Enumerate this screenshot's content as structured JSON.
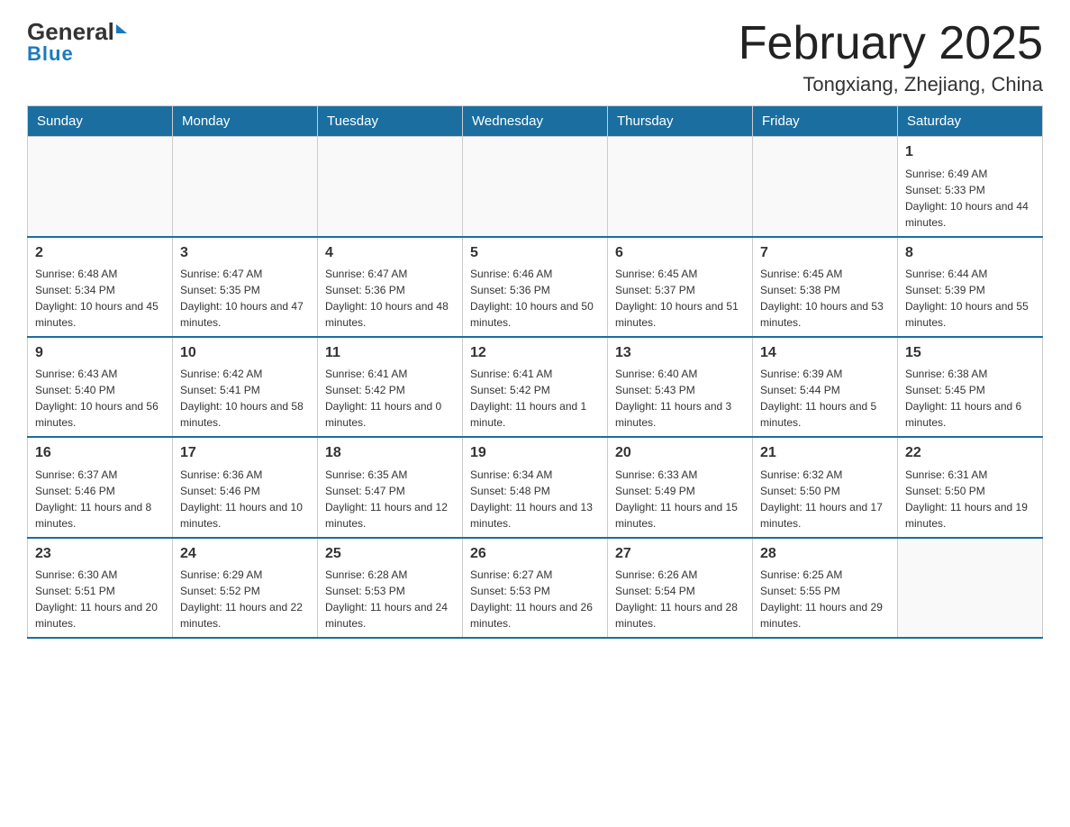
{
  "header": {
    "logo_general": "General",
    "logo_blue": "Blue",
    "title": "February 2025",
    "subtitle": "Tongxiang, Zhejiang, China"
  },
  "weekdays": [
    "Sunday",
    "Monday",
    "Tuesday",
    "Wednesday",
    "Thursday",
    "Friday",
    "Saturday"
  ],
  "weeks": [
    [
      {
        "day": "",
        "info": ""
      },
      {
        "day": "",
        "info": ""
      },
      {
        "day": "",
        "info": ""
      },
      {
        "day": "",
        "info": ""
      },
      {
        "day": "",
        "info": ""
      },
      {
        "day": "",
        "info": ""
      },
      {
        "day": "1",
        "info": "Sunrise: 6:49 AM\nSunset: 5:33 PM\nDaylight: 10 hours and 44 minutes."
      }
    ],
    [
      {
        "day": "2",
        "info": "Sunrise: 6:48 AM\nSunset: 5:34 PM\nDaylight: 10 hours and 45 minutes."
      },
      {
        "day": "3",
        "info": "Sunrise: 6:47 AM\nSunset: 5:35 PM\nDaylight: 10 hours and 47 minutes."
      },
      {
        "day": "4",
        "info": "Sunrise: 6:47 AM\nSunset: 5:36 PM\nDaylight: 10 hours and 48 minutes."
      },
      {
        "day": "5",
        "info": "Sunrise: 6:46 AM\nSunset: 5:36 PM\nDaylight: 10 hours and 50 minutes."
      },
      {
        "day": "6",
        "info": "Sunrise: 6:45 AM\nSunset: 5:37 PM\nDaylight: 10 hours and 51 minutes."
      },
      {
        "day": "7",
        "info": "Sunrise: 6:45 AM\nSunset: 5:38 PM\nDaylight: 10 hours and 53 minutes."
      },
      {
        "day": "8",
        "info": "Sunrise: 6:44 AM\nSunset: 5:39 PM\nDaylight: 10 hours and 55 minutes."
      }
    ],
    [
      {
        "day": "9",
        "info": "Sunrise: 6:43 AM\nSunset: 5:40 PM\nDaylight: 10 hours and 56 minutes."
      },
      {
        "day": "10",
        "info": "Sunrise: 6:42 AM\nSunset: 5:41 PM\nDaylight: 10 hours and 58 minutes."
      },
      {
        "day": "11",
        "info": "Sunrise: 6:41 AM\nSunset: 5:42 PM\nDaylight: 11 hours and 0 minutes."
      },
      {
        "day": "12",
        "info": "Sunrise: 6:41 AM\nSunset: 5:42 PM\nDaylight: 11 hours and 1 minute."
      },
      {
        "day": "13",
        "info": "Sunrise: 6:40 AM\nSunset: 5:43 PM\nDaylight: 11 hours and 3 minutes."
      },
      {
        "day": "14",
        "info": "Sunrise: 6:39 AM\nSunset: 5:44 PM\nDaylight: 11 hours and 5 minutes."
      },
      {
        "day": "15",
        "info": "Sunrise: 6:38 AM\nSunset: 5:45 PM\nDaylight: 11 hours and 6 minutes."
      }
    ],
    [
      {
        "day": "16",
        "info": "Sunrise: 6:37 AM\nSunset: 5:46 PM\nDaylight: 11 hours and 8 minutes."
      },
      {
        "day": "17",
        "info": "Sunrise: 6:36 AM\nSunset: 5:46 PM\nDaylight: 11 hours and 10 minutes."
      },
      {
        "day": "18",
        "info": "Sunrise: 6:35 AM\nSunset: 5:47 PM\nDaylight: 11 hours and 12 minutes."
      },
      {
        "day": "19",
        "info": "Sunrise: 6:34 AM\nSunset: 5:48 PM\nDaylight: 11 hours and 13 minutes."
      },
      {
        "day": "20",
        "info": "Sunrise: 6:33 AM\nSunset: 5:49 PM\nDaylight: 11 hours and 15 minutes."
      },
      {
        "day": "21",
        "info": "Sunrise: 6:32 AM\nSunset: 5:50 PM\nDaylight: 11 hours and 17 minutes."
      },
      {
        "day": "22",
        "info": "Sunrise: 6:31 AM\nSunset: 5:50 PM\nDaylight: 11 hours and 19 minutes."
      }
    ],
    [
      {
        "day": "23",
        "info": "Sunrise: 6:30 AM\nSunset: 5:51 PM\nDaylight: 11 hours and 20 minutes."
      },
      {
        "day": "24",
        "info": "Sunrise: 6:29 AM\nSunset: 5:52 PM\nDaylight: 11 hours and 22 minutes."
      },
      {
        "day": "25",
        "info": "Sunrise: 6:28 AM\nSunset: 5:53 PM\nDaylight: 11 hours and 24 minutes."
      },
      {
        "day": "26",
        "info": "Sunrise: 6:27 AM\nSunset: 5:53 PM\nDaylight: 11 hours and 26 minutes."
      },
      {
        "day": "27",
        "info": "Sunrise: 6:26 AM\nSunset: 5:54 PM\nDaylight: 11 hours and 28 minutes."
      },
      {
        "day": "28",
        "info": "Sunrise: 6:25 AM\nSunset: 5:55 PM\nDaylight: 11 hours and 29 minutes."
      },
      {
        "day": "",
        "info": ""
      }
    ]
  ]
}
